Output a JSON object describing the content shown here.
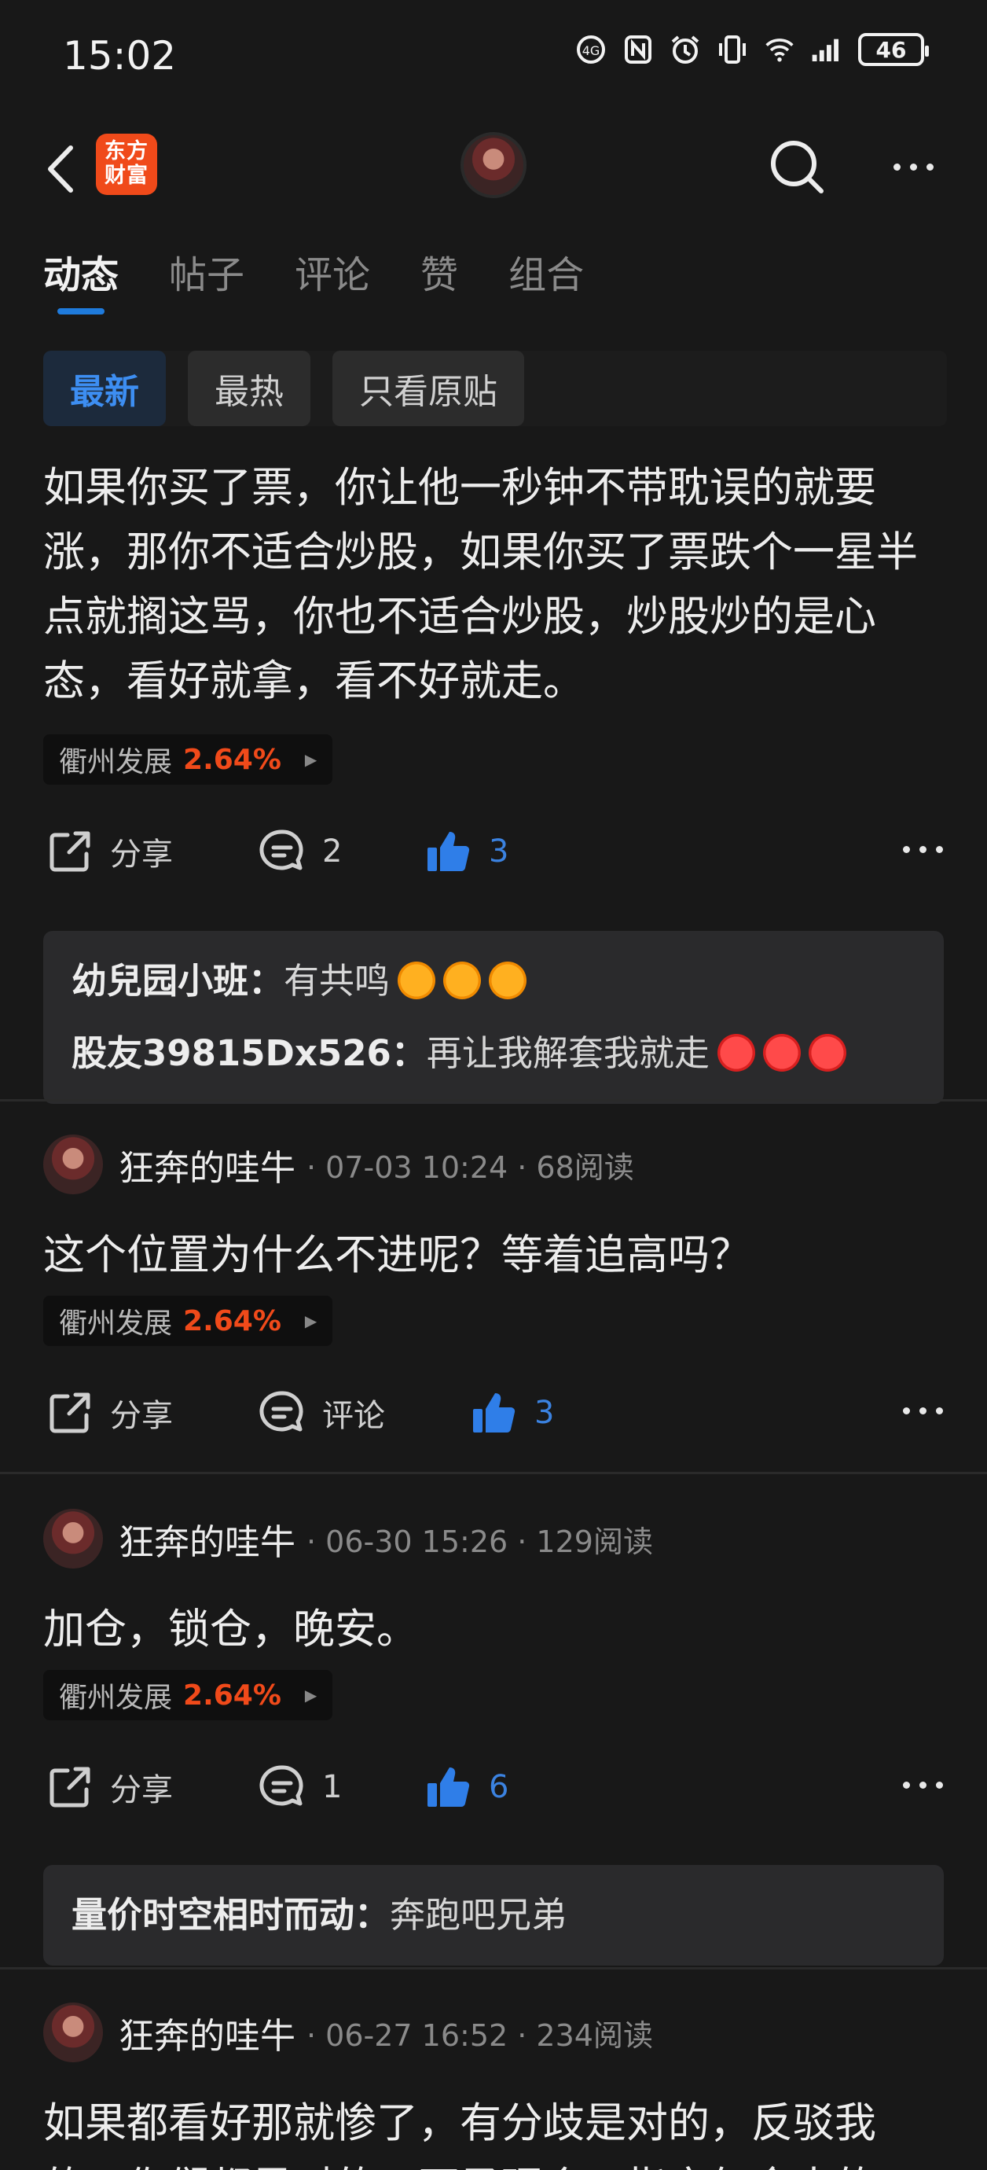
{
  "status_bar": {
    "time": "15:02",
    "battery": "46",
    "icons": [
      "hd-icon",
      "nfc-icon",
      "alarm-icon",
      "vibrate-icon",
      "wifi-icon",
      "signal-icon"
    ]
  },
  "nav": {
    "logo_line1": "东方",
    "logo_line2": "财富",
    "icons": [
      "back-arrow-icon",
      "search-icon",
      "more-icon"
    ]
  },
  "tabs": [
    "动态",
    "帖子",
    "评论",
    "赞",
    "组合"
  ],
  "filters": [
    "最新",
    "最热",
    "只看原贴"
  ],
  "posts": [
    {
      "text": "如果你买了票，你让他一秒钟不带耽误的就要涨，那你不适合炒股，如果你买了票跌个一星半点就搁这骂，你也不适合炒股，炒股炒的是心态，看好就拿，看不好就走。",
      "stock": "衢州发展",
      "pct": "2.64%",
      "share": "分享",
      "comments": "2",
      "likes": "3",
      "replies": [
        {
          "author": "幼兒园小班：",
          "text": "有共鸣"
        },
        {
          "author": "股友39815Dx526：",
          "text": "再让我解套我就走"
        }
      ]
    },
    {
      "author": "狂奔的哇牛",
      "meta": "· 07-03 10:24 · 68阅读",
      "text": "这个位置为什么不进呢？等着追高吗？",
      "stock": "衢州发展",
      "pct": "2.64%",
      "share": "分享",
      "comments": "评论",
      "likes": "3"
    },
    {
      "author": "狂奔的哇牛",
      "meta": "· 06-30 15:26 · 129阅读",
      "text": "加仓，锁仓，晚安。",
      "stock": "衢州发展",
      "pct": "2.64%",
      "share": "分享",
      "comments": "1",
      "likes": "6",
      "replies": [
        {
          "author": "量价时空相时而动：",
          "text": "奔跑吧兄弟"
        }
      ]
    },
    {
      "author": "狂奔的哇牛",
      "meta": "· 06-27 16:52 · 234阅读",
      "text": "如果都看好那就惨了，有分歧是对的，反驳我的，你们都是对的，不予理会，指育气命大的"
    }
  ],
  "colors": {
    "background": "#181818",
    "accent_blue": "#3b82e0",
    "rise_red": "#f04a1a"
  }
}
